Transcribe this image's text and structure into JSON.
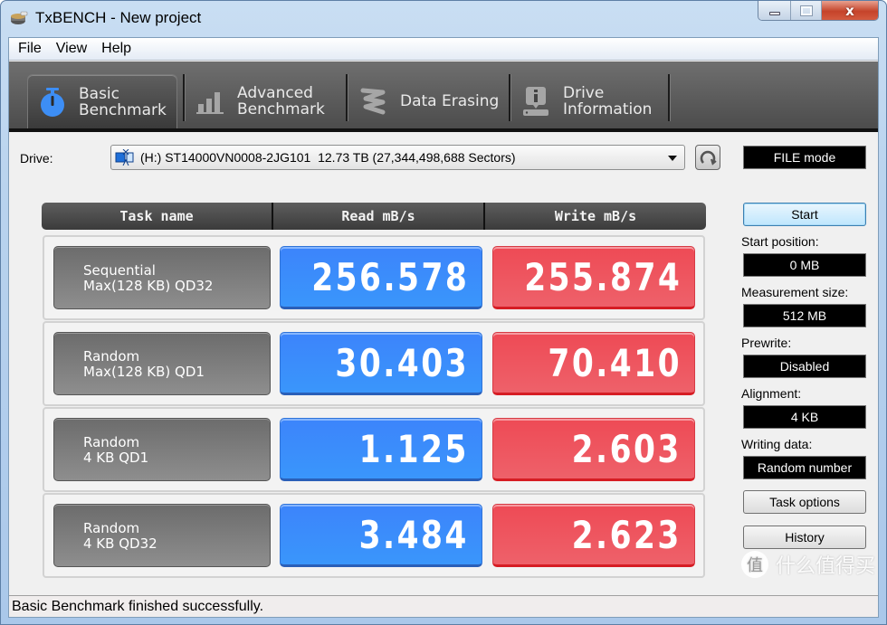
{
  "window": {
    "title": "TxBENCH - New project",
    "controls": {
      "minimize": "minimize",
      "maximize": "maximize",
      "close": "x"
    }
  },
  "menu": [
    "File",
    "View",
    "Help"
  ],
  "tabs": [
    {
      "label": "Basic\nBenchmark",
      "icon": "stopwatch-icon",
      "active": true
    },
    {
      "label": "Advanced\nBenchmark",
      "icon": "bar-chart-icon",
      "active": false
    },
    {
      "label": "Data Erasing",
      "icon": "eraser-icon",
      "active": false
    },
    {
      "label": "Drive\nInformation",
      "icon": "drive-info-icon",
      "active": false
    }
  ],
  "drive": {
    "label": "Drive:",
    "selected": "(H:) ST14000VN0008-2JG101  12.73 TB (27,344,498,688 Sectors)",
    "mode": "FILE mode"
  },
  "grid": {
    "headers": {
      "task": "Task name",
      "read": "Read mB/s",
      "write": "Write mB/s"
    },
    "rows": [
      {
        "task": "Sequential\nMax(128 KB) QD32",
        "read": "256.578",
        "write": "255.874"
      },
      {
        "task": "Random\nMax(128 KB) QD1",
        "read": "30.403",
        "write": "70.410"
      },
      {
        "task": "Random\n4 KB QD1",
        "read": "1.125",
        "write": "2.603"
      },
      {
        "task": "Random\n4 KB QD32",
        "read": "3.484",
        "write": "2.623"
      }
    ]
  },
  "side": {
    "start_label": "Start",
    "fields": [
      {
        "label": "Start position:",
        "value": "0 MB"
      },
      {
        "label": "Measurement size:",
        "value": "512 MB"
      },
      {
        "label": "Prewrite:",
        "value": "Disabled"
      },
      {
        "label": "Alignment:",
        "value": "4 KB"
      },
      {
        "label": "Writing data:",
        "value": "Random number"
      }
    ],
    "task_options_label": "Task options",
    "history_label": "History"
  },
  "status": "Basic Benchmark finished successfully.",
  "watermark": {
    "badge": "值",
    "text": "什么值得买"
  },
  "colors": {
    "read": "#3c8cfb",
    "write": "#ee5560",
    "toolbar": "#5a5a5a"
  }
}
